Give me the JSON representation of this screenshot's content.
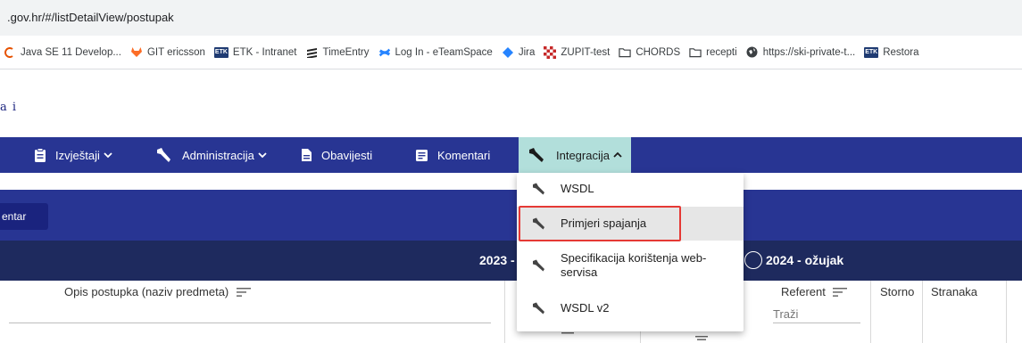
{
  "browser": {
    "address": ".gov.hr/#/listDetailView/postupak",
    "bookmarks": [
      {
        "label": "Java SE 11 Develop...",
        "icon": "java-icon",
        "color": "#e65100"
      },
      {
        "label": "GIT ericsson",
        "icon": "gitlab-icon",
        "color": "#fc6d26"
      },
      {
        "label": "ETK - Intranet",
        "icon": "etk-icon",
        "badge": "ETK",
        "color": "#1f3b72"
      },
      {
        "label": "TimeEntry",
        "icon": "stripes-icon",
        "color": "#222222"
      },
      {
        "label": "Log In - eTeamSpace",
        "icon": "confluence-icon",
        "color": "#2684ff"
      },
      {
        "label": "Jira",
        "icon": "jira-icon",
        "color": "#2684ff"
      },
      {
        "label": "ZUPIT-test",
        "icon": "checkered-icon",
        "color": "#c62828"
      },
      {
        "label": "CHORDS",
        "icon": "folder-icon",
        "color": "#3c4043"
      },
      {
        "label": "recepti",
        "icon": "folder-icon",
        "color": "#3c4043"
      },
      {
        "label": "https://ski-private-t...",
        "icon": "globe-icon",
        "color": "#3c4043"
      },
      {
        "label": "Restora",
        "icon": "etk-icon",
        "badge": "ETK",
        "color": "#1f3b72"
      }
    ]
  },
  "site": {
    "logo_fragment": "a i"
  },
  "nav": {
    "items": [
      {
        "label": "Izvještaji",
        "icon": "clipboard-icon",
        "has_dropdown": true
      },
      {
        "label": "Administracija",
        "icon": "wrench-icon",
        "has_dropdown": true
      },
      {
        "label": "Obavijesti",
        "icon": "document-icon",
        "has_dropdown": false
      },
      {
        "label": "Komentari",
        "icon": "comment-icon",
        "has_dropdown": false
      },
      {
        "label": "Integracija",
        "icon": "wrench-icon",
        "has_dropdown": true,
        "expanded": true
      }
    ],
    "colors": {
      "bar": "#283593",
      "active": "#b2dfdb"
    }
  },
  "dropdown": {
    "items": [
      {
        "label": "WSDL",
        "icon": "wrench-icon"
      },
      {
        "label": "Primjeri spajanja",
        "icon": "wrench-icon",
        "highlighted": true
      },
      {
        "label": "Specifikacija korištenja web-servisa",
        "label_line1": "Specifikacija korištenja web-",
        "label_line2": "servisa",
        "icon": "wrench-icon"
      },
      {
        "label": "WSDL v2",
        "icon": "wrench-icon"
      }
    ],
    "highlight_color": "#e53935"
  },
  "toolbar": {
    "button_fragment": "entar"
  },
  "year_selector": {
    "left_label": "2023 -",
    "right_label": "2024 - ožujak"
  },
  "table": {
    "headers": {
      "opis": "Opis postupka (naziv predmeta)",
      "referent": "Referent",
      "storno": "Storno",
      "stranaka": "Stranaka"
    },
    "fragments": {
      "postupka": "postupka"
    },
    "search_placeholder": "Traži"
  }
}
